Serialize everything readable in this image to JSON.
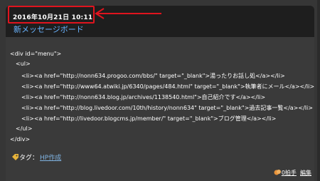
{
  "post": {
    "date": "2016年10月21日 10:11",
    "title": "新メッセージボード"
  },
  "code_lines": [
    "<div id=\"menu\">",
    "<ul>",
    "<li><a href=\"http://nonn634.progoo.com/bbs/\" target=\"_blank\">湯ったりお話し処</a></li>",
    "<li><a href=\"http://www64.atwiki.jp/6340/pages/484.html\" target=\"_blank\">執筆者にメール</a></li>",
    "<li><a href=\"http://nonn634.blog.jp/archives/1138540.html\">自己紹介です</a></li>",
    "<li><a href=\"http://blog.livedoor.com/10th/history/nonn634\" target=\"_blank\">過去記事一覧</a></li>",
    "<li><a href=\"http://livedoor.blogcms.jp/member/\" target=\"_blank\">ブログ管理</a></li>",
    "</ul>",
    "</div>"
  ],
  "tags": {
    "label": "タグ：",
    "link": "HP作成"
  },
  "footer": {
    "clap_label": "0拍手",
    "edit_label": "編集"
  },
  "colors": {
    "annotation": "#e0141e",
    "title_link": "#6ab4ff"
  }
}
